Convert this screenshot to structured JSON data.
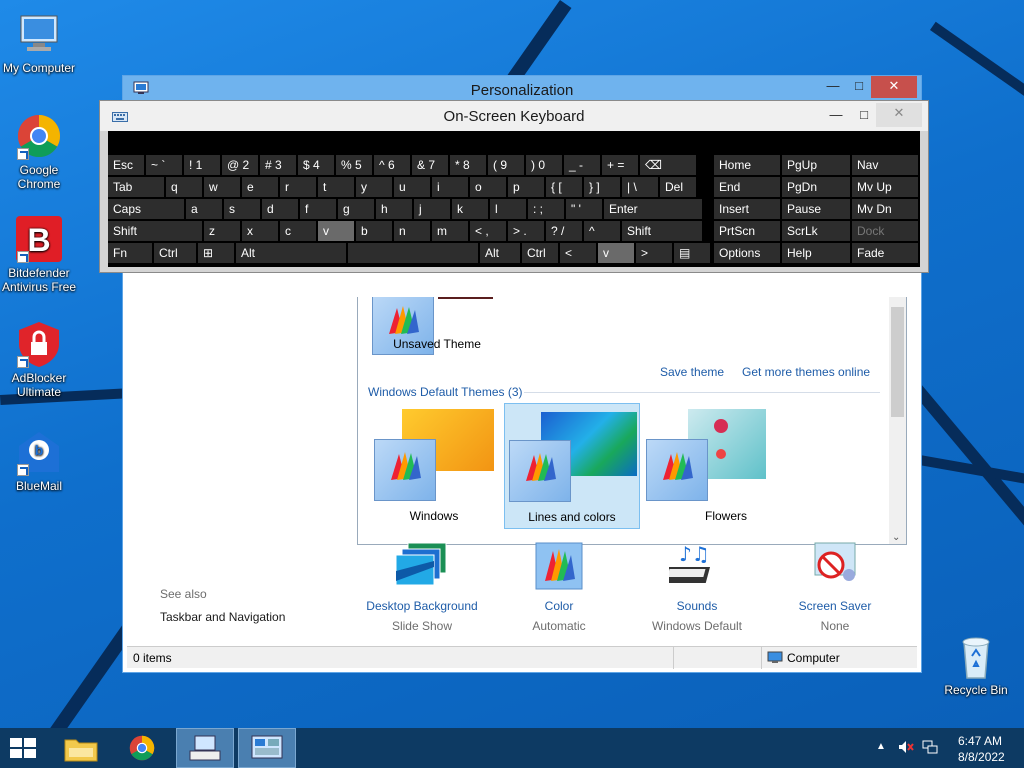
{
  "desktop": {
    "icons": [
      {
        "label": "My Computer",
        "icon": "computer-icon"
      },
      {
        "label": "Google Chrome",
        "icon": "chrome-icon"
      },
      {
        "label": "Bitdefender Antivirus Free",
        "icon": "bitdefender-icon"
      },
      {
        "label": "AdBlocker Ultimate",
        "icon": "adblocker-icon"
      },
      {
        "label": "BlueMail",
        "icon": "bluemail-icon"
      },
      {
        "label": "Recycle Bin",
        "icon": "recycle-bin-icon"
      }
    ]
  },
  "personalization": {
    "title": "Personalization",
    "themes": {
      "unsaved": "Unsaved Theme",
      "save_link": "Save theme",
      "more_link": "Get more themes online",
      "group_header": "Windows Default Themes (3)",
      "items": [
        "Windows",
        "Lines and colors",
        "Flowers"
      ],
      "selected": "Lines and colors"
    },
    "see_also": {
      "header": "See also",
      "link": "Taskbar and Navigation"
    },
    "bottom": [
      {
        "label": "Desktop Background",
        "sub": "Slide Show"
      },
      {
        "label": "Color",
        "sub": "Automatic"
      },
      {
        "label": "Sounds",
        "sub": "Windows Default"
      },
      {
        "label": "Screen Saver",
        "sub": "None"
      }
    ],
    "status": {
      "items": "0 items",
      "location": "Computer"
    }
  },
  "osk": {
    "title": "On-Screen Keyboard",
    "rows": [
      [
        "Esc",
        "~ `",
        "! 1",
        "@ 2",
        "# 3",
        "$ 4",
        "% 5",
        "^ 6",
        "& 7",
        "* 8",
        "( 9",
        ") 0",
        "_ -",
        "+ =",
        "⌫"
      ],
      [
        "Tab",
        "q",
        "w",
        "e",
        "r",
        "t",
        "y",
        "u",
        "i",
        "o",
        "p",
        "{ [",
        "} ]",
        "| \\",
        "Del"
      ],
      [
        "Caps",
        "a",
        "s",
        "d",
        "f",
        "g",
        "h",
        "j",
        "k",
        "l",
        ": ;",
        "\" '",
        "Enter"
      ],
      [
        "Shift",
        "z",
        "x",
        "c",
        "v",
        "b",
        "n",
        "m",
        "< ,",
        "> .",
        "? /",
        "^",
        "Shift"
      ],
      [
        "Fn",
        "Ctrl",
        "⊞",
        "Alt",
        "",
        "Alt",
        "Ctrl",
        "<",
        "v",
        ">",
        "▤"
      ]
    ],
    "nav_keys": [
      [
        "Home",
        "PgUp",
        "Nav"
      ],
      [
        "End",
        "PgDn",
        "Mv Up"
      ],
      [
        "Insert",
        "Pause",
        "Mv Dn"
      ],
      [
        "PrtScn",
        "ScrLk",
        "Dock"
      ],
      [
        "Options",
        "Help",
        "Fade"
      ]
    ],
    "highlighted_key": "v"
  },
  "taskbar": {
    "time": "6:47 AM",
    "date": "8/8/2022"
  },
  "colors": {
    "desktop_blue": "#0f78d7",
    "link_blue": "#1e5ca8",
    "close_red": "#c7504c",
    "taskbar": "#0d3a63"
  }
}
